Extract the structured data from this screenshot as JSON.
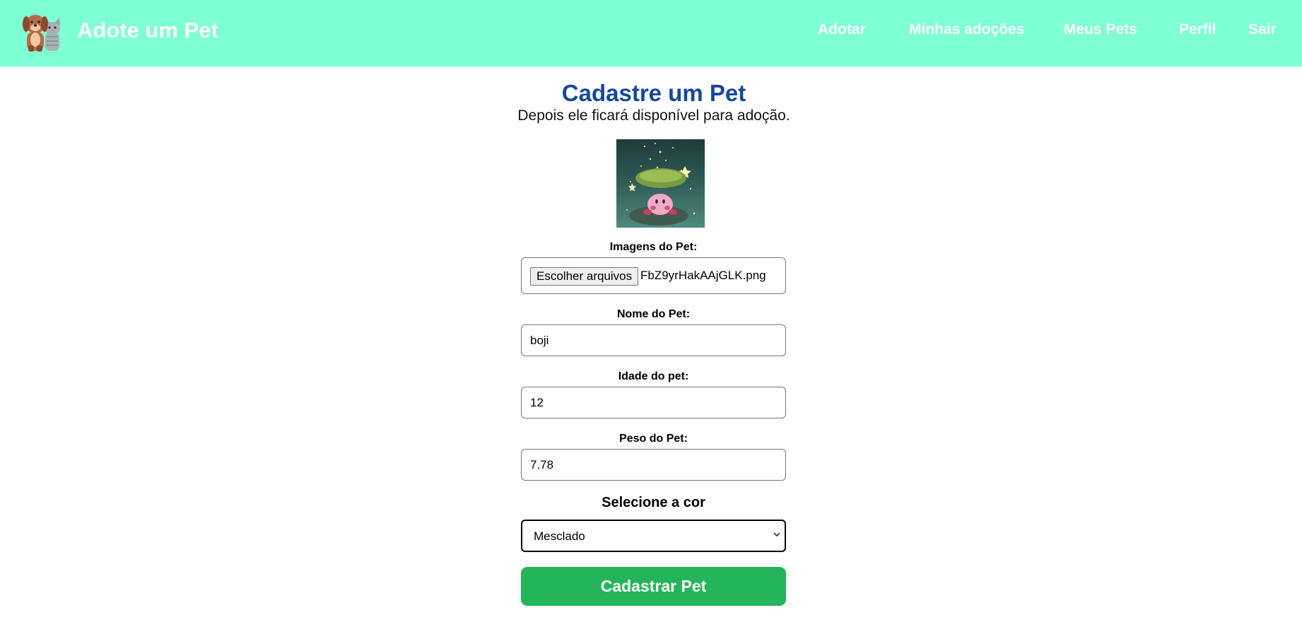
{
  "header": {
    "brand": "Adote um Pet",
    "logo_icon": "dog-and-cat-icon",
    "nav": {
      "adotar": "Adotar",
      "minhas_adocoes": "Minhas adoções",
      "meus_pets": "Meus Pets",
      "perfil": "Perfil",
      "sair": "Sair"
    },
    "background_color": "#7fffd4"
  },
  "form": {
    "title": "Cadastre um Pet",
    "subtitle": "Depois ele ficará disponível para adoção.",
    "images_label": "Imagens do Pet:",
    "file_button": "Escolher arquivos",
    "file_name": "FbZ9yrHakAAjGLK.png",
    "name_label": "Nome do Pet:",
    "name_value": "boji",
    "age_label": "Idade do pet:",
    "age_value": "12",
    "weight_label": "Peso do Pet:",
    "weight_value": "7.78",
    "color_heading": "Selecione a cor",
    "color_selected": "Mesclado",
    "submit": "Cadastrar Pet",
    "title_color": "#16479c",
    "submit_color": "#24b55a"
  }
}
